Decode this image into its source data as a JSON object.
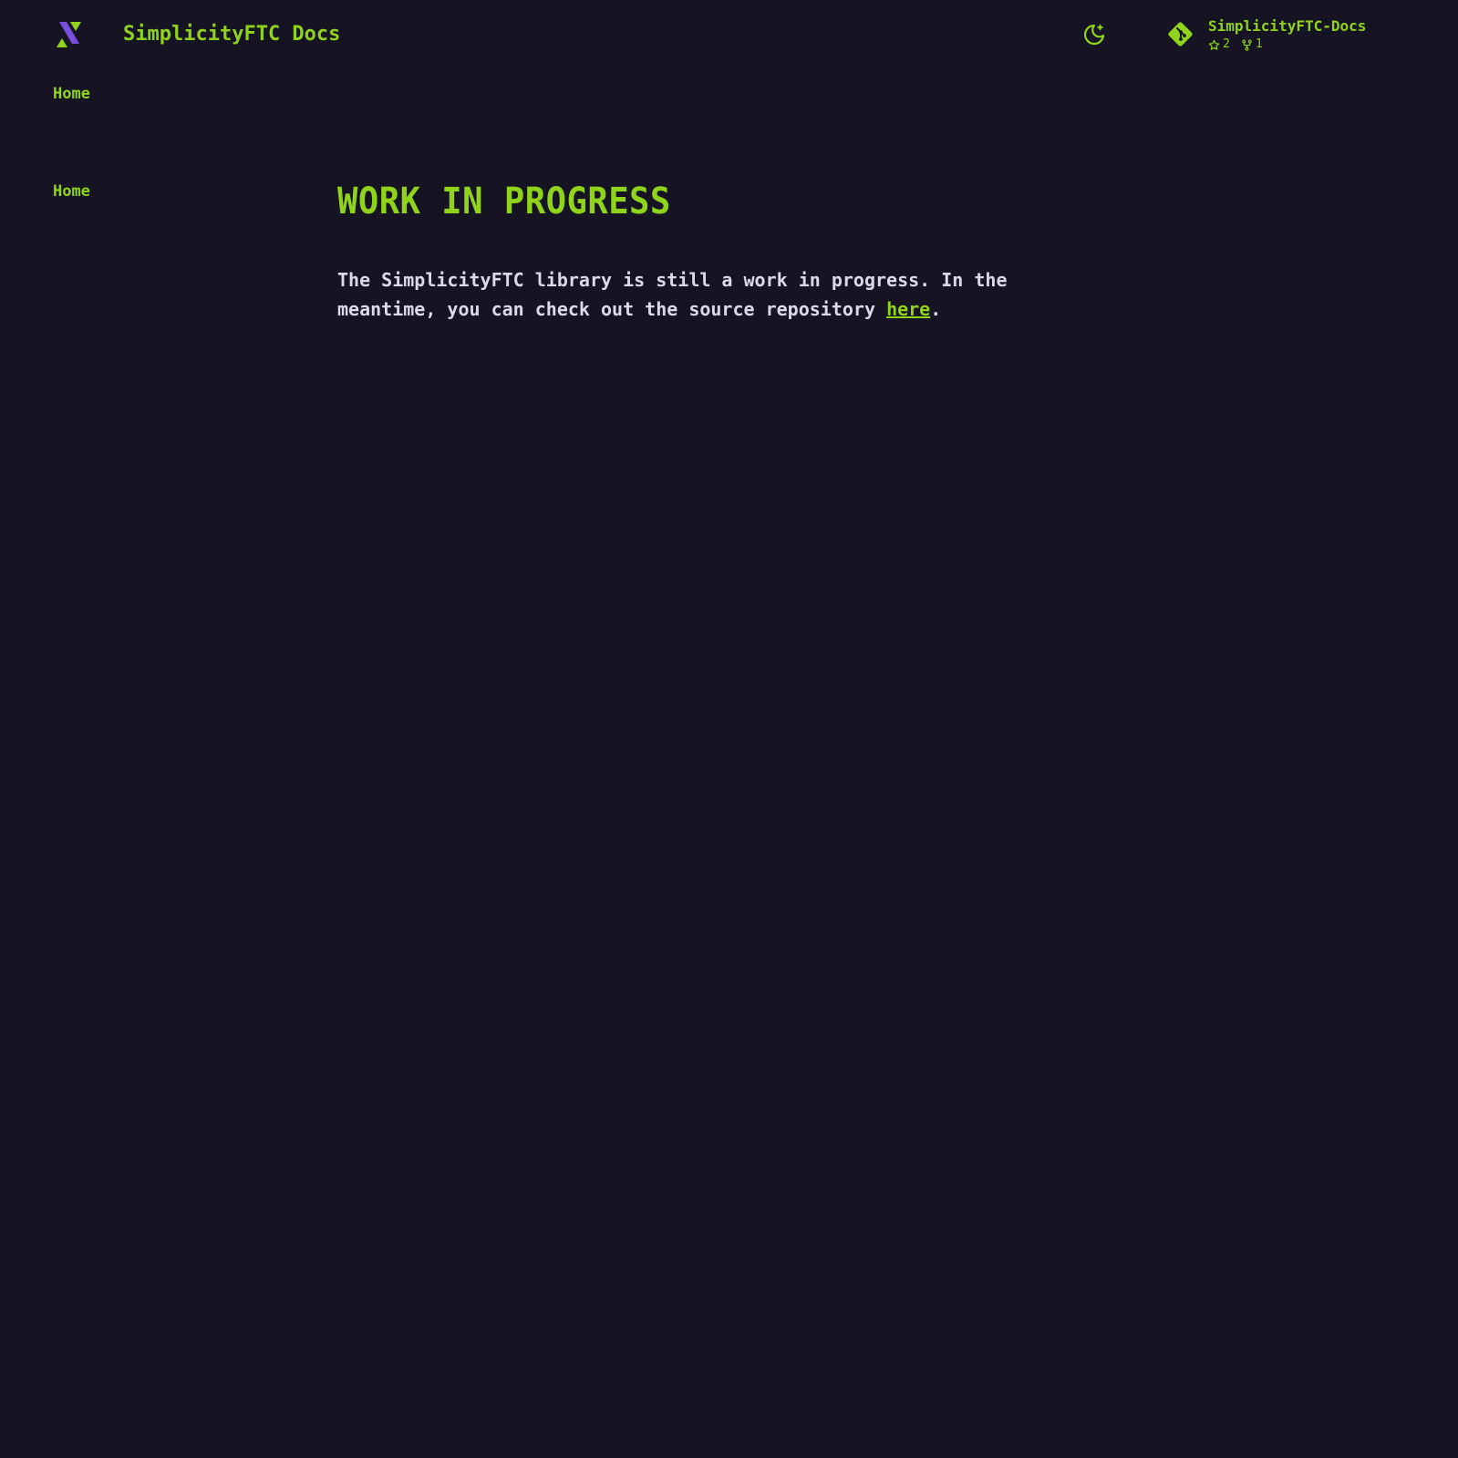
{
  "header": {
    "site_title": "SimplicityFTC Docs",
    "repo": {
      "name": "SimplicityFTC-Docs",
      "stars": "2",
      "forks": "1"
    }
  },
  "tabs": {
    "home_label": "Home"
  },
  "sidebar": {
    "items": [
      {
        "label": "Home"
      }
    ]
  },
  "main": {
    "title": "WORK IN PROGRESS",
    "paragraph_before_link": "The SimplicityFTC library is still a work in progress. In the meantime, you can check out the source repository ",
    "link_text": "here",
    "paragraph_after_link": "."
  },
  "colors": {
    "background": "#161323",
    "accent": "#8fd41b",
    "text": "#dcd9e8",
    "logo_purple": "#7a4fe0"
  },
  "icons": {
    "logo": "simplicityftc-logo-icon",
    "theme": "moon-star-icon",
    "repo": "git-icon",
    "stars": "star-icon",
    "forks": "fork-icon"
  }
}
